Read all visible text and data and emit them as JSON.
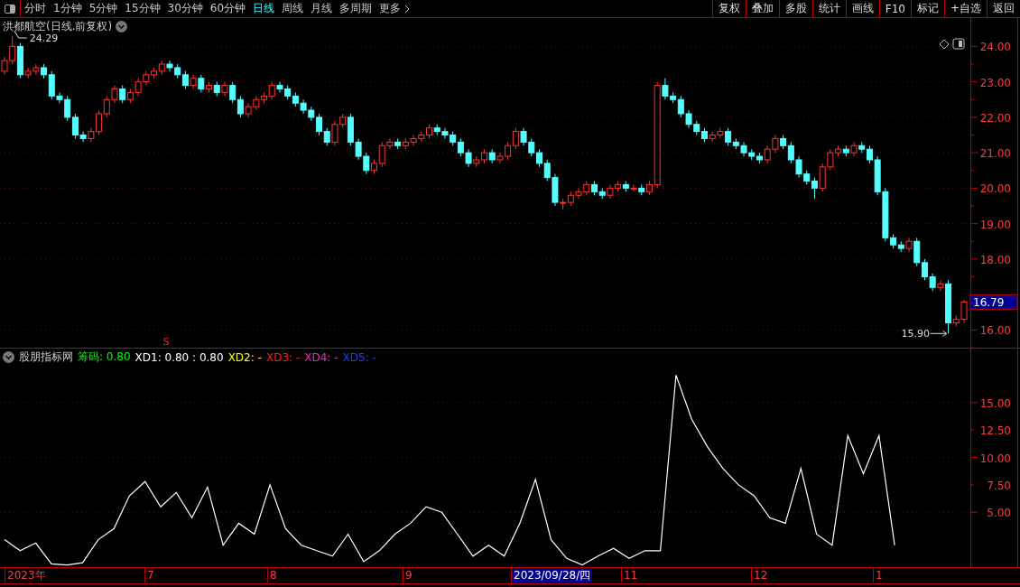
{
  "toolbar": {
    "periods": [
      {
        "label": "分时",
        "selected": false
      },
      {
        "label": "1分钟",
        "selected": false
      },
      {
        "label": "5分钟",
        "selected": false
      },
      {
        "label": "15分钟",
        "selected": false
      },
      {
        "label": "30分钟",
        "selected": false
      },
      {
        "label": "60分钟",
        "selected": false
      },
      {
        "label": "日线",
        "selected": true
      },
      {
        "label": "周线",
        "selected": false
      },
      {
        "label": "月线",
        "selected": false
      },
      {
        "label": "多周期",
        "selected": false
      }
    ],
    "more": "更多",
    "buttons": [
      "复权",
      "叠加",
      "多股",
      "统计",
      "画线",
      "F10",
      "标记",
      "+自选",
      "返回"
    ]
  },
  "price_panel": {
    "title": "洪都航空(日线.前复权)",
    "high_label": "24.29",
    "low_label": "15.90",
    "last_price": "16.79",
    "signal_mark": "S",
    "chart_data": {
      "type": "candlestick",
      "grid": true,
      "ylim": [
        15.5,
        24.8
      ],
      "yticks": [
        {
          "value": 24,
          "label": "24.00"
        },
        {
          "value": 23,
          "label": "23.00"
        },
        {
          "value": 22,
          "label": "22.00"
        },
        {
          "value": 21,
          "label": "21.00"
        },
        {
          "value": 20,
          "label": "20.00"
        },
        {
          "value": 19,
          "label": "19.00"
        },
        {
          "value": 18,
          "label": "18.00"
        },
        {
          "value": 16,
          "label": "16.00"
        }
      ],
      "ohlc": [
        [
          23.3,
          23.7,
          23.2,
          23.6
        ],
        [
          23.6,
          24.29,
          23.5,
          24.0
        ],
        [
          24.0,
          24.1,
          23.1,
          23.2
        ],
        [
          23.2,
          23.4,
          23.1,
          23.3
        ],
        [
          23.3,
          23.5,
          23.2,
          23.4
        ],
        [
          23.4,
          23.5,
          23.1,
          23.2
        ],
        [
          23.2,
          23.3,
          22.5,
          22.6
        ],
        [
          22.6,
          22.7,
          22.4,
          22.5
        ],
        [
          22.5,
          22.6,
          21.9,
          22.0
        ],
        [
          22.0,
          22.1,
          21.4,
          21.5
        ],
        [
          21.5,
          21.6,
          21.3,
          21.4
        ],
        [
          21.4,
          21.7,
          21.3,
          21.6
        ],
        [
          21.6,
          22.2,
          21.5,
          22.1
        ],
        [
          22.1,
          22.6,
          22.0,
          22.5
        ],
        [
          22.5,
          22.9,
          22.4,
          22.8
        ],
        [
          22.8,
          22.9,
          22.4,
          22.5
        ],
        [
          22.5,
          22.8,
          22.4,
          22.7
        ],
        [
          22.7,
          23.1,
          22.6,
          23.0
        ],
        [
          23.0,
          23.3,
          22.9,
          23.2
        ],
        [
          23.2,
          23.4,
          23.1,
          23.3
        ],
        [
          23.3,
          23.6,
          23.2,
          23.5
        ],
        [
          23.5,
          23.6,
          23.3,
          23.4
        ],
        [
          23.4,
          23.5,
          23.1,
          23.2
        ],
        [
          23.2,
          23.3,
          22.8,
          22.9
        ],
        [
          22.9,
          23.2,
          22.8,
          23.1
        ],
        [
          23.1,
          23.2,
          22.7,
          22.8
        ],
        [
          22.8,
          23.0,
          22.7,
          22.9
        ],
        [
          22.9,
          23.0,
          22.6,
          22.7
        ],
        [
          22.7,
          23.0,
          22.6,
          22.9
        ],
        [
          22.9,
          23.0,
          22.4,
          22.5
        ],
        [
          22.5,
          22.6,
          22.0,
          22.1
        ],
        [
          22.1,
          22.4,
          22.0,
          22.3
        ],
        [
          22.3,
          22.6,
          22.2,
          22.5
        ],
        [
          22.5,
          22.7,
          22.4,
          22.6
        ],
        [
          22.6,
          23.0,
          22.5,
          22.9
        ],
        [
          22.9,
          23.0,
          22.7,
          22.8
        ],
        [
          22.8,
          22.9,
          22.5,
          22.6
        ],
        [
          22.6,
          22.7,
          22.3,
          22.4
        ],
        [
          22.4,
          22.5,
          22.1,
          22.2
        ],
        [
          22.2,
          22.3,
          21.9,
          22.0
        ],
        [
          22.0,
          22.1,
          21.5,
          21.6
        ],
        [
          21.6,
          21.7,
          21.2,
          21.3
        ],
        [
          21.3,
          21.9,
          21.2,
          21.8
        ],
        [
          21.8,
          22.1,
          21.7,
          22.0
        ],
        [
          22.0,
          22.1,
          21.2,
          21.3
        ],
        [
          21.3,
          21.4,
          20.8,
          20.9
        ],
        [
          20.9,
          21.0,
          20.4,
          20.5
        ],
        [
          20.5,
          20.8,
          20.4,
          20.7
        ],
        [
          20.7,
          21.3,
          20.6,
          21.2
        ],
        [
          21.2,
          21.4,
          21.1,
          21.3
        ],
        [
          21.3,
          21.4,
          21.1,
          21.2
        ],
        [
          21.2,
          21.4,
          21.1,
          21.3
        ],
        [
          21.3,
          21.5,
          21.2,
          21.4
        ],
        [
          21.4,
          21.6,
          21.3,
          21.5
        ],
        [
          21.5,
          21.8,
          21.4,
          21.7
        ],
        [
          21.7,
          21.8,
          21.5,
          21.6
        ],
        [
          21.6,
          21.7,
          21.4,
          21.5
        ],
        [
          21.5,
          21.6,
          21.2,
          21.3
        ],
        [
          21.3,
          21.4,
          20.9,
          21.0
        ],
        [
          21.0,
          21.1,
          20.6,
          20.7
        ],
        [
          20.7,
          20.9,
          20.6,
          20.8
        ],
        [
          20.8,
          21.1,
          20.7,
          21.0
        ],
        [
          21.0,
          21.1,
          20.7,
          20.8
        ],
        [
          20.8,
          21.0,
          20.7,
          20.9
        ],
        [
          20.9,
          21.3,
          20.8,
          21.2
        ],
        [
          21.2,
          21.7,
          21.1,
          21.6
        ],
        [
          21.6,
          21.7,
          21.2,
          21.3
        ],
        [
          21.3,
          21.4,
          20.9,
          21.0
        ],
        [
          21.0,
          21.1,
          20.6,
          20.7
        ],
        [
          20.7,
          20.8,
          20.2,
          20.3
        ],
        [
          20.3,
          20.4,
          19.5,
          19.6
        ],
        [
          19.6,
          19.7,
          19.4,
          19.6
        ],
        [
          19.6,
          19.9,
          19.5,
          19.8
        ],
        [
          19.8,
          20.0,
          19.7,
          19.9
        ],
        [
          19.9,
          20.2,
          19.8,
          20.1
        ],
        [
          20.1,
          20.2,
          19.8,
          19.9
        ],
        [
          19.9,
          20.0,
          19.7,
          19.8
        ],
        [
          19.8,
          20.1,
          19.7,
          20.0
        ],
        [
          20.0,
          20.2,
          19.9,
          20.1
        ],
        [
          20.1,
          20.2,
          19.9,
          20.0
        ],
        [
          20.0,
          20.1,
          19.9,
          20.0
        ],
        [
          20.0,
          20.1,
          19.8,
          19.9
        ],
        [
          19.9,
          20.2,
          19.8,
          20.1
        ],
        [
          20.1,
          23.0,
          20.0,
          22.9
        ],
        [
          22.9,
          23.1,
          22.5,
          22.6
        ],
        [
          22.6,
          22.7,
          22.4,
          22.5
        ],
        [
          22.5,
          22.6,
          22.0,
          22.1
        ],
        [
          22.1,
          22.2,
          21.7,
          21.8
        ],
        [
          21.8,
          21.9,
          21.5,
          21.6
        ],
        [
          21.6,
          21.7,
          21.3,
          21.4
        ],
        [
          21.4,
          21.6,
          21.3,
          21.5
        ],
        [
          21.5,
          21.7,
          21.4,
          21.6
        ],
        [
          21.6,
          21.7,
          21.2,
          21.3
        ],
        [
          21.3,
          21.4,
          21.1,
          21.2
        ],
        [
          21.2,
          21.3,
          20.9,
          21.0
        ],
        [
          21.0,
          21.1,
          20.8,
          20.9
        ],
        [
          20.9,
          21.0,
          20.7,
          20.8
        ],
        [
          20.8,
          21.2,
          20.7,
          21.1
        ],
        [
          21.1,
          21.5,
          21.0,
          21.4
        ],
        [
          21.4,
          21.5,
          21.1,
          21.2
        ],
        [
          21.2,
          21.3,
          20.7,
          20.8
        ],
        [
          20.8,
          20.9,
          20.3,
          20.4
        ],
        [
          20.4,
          20.5,
          20.1,
          20.2
        ],
        [
          20.2,
          20.3,
          19.7,
          20.0
        ],
        [
          20.0,
          20.7,
          19.9,
          20.6
        ],
        [
          20.6,
          21.1,
          20.5,
          21.0
        ],
        [
          21.0,
          21.2,
          20.9,
          21.1
        ],
        [
          21.1,
          21.2,
          20.9,
          21.0
        ],
        [
          21.0,
          21.3,
          20.9,
          21.2
        ],
        [
          21.2,
          21.3,
          21.0,
          21.1
        ],
        [
          21.1,
          21.2,
          20.7,
          20.8
        ],
        [
          20.8,
          20.9,
          19.8,
          19.9
        ],
        [
          19.9,
          20.0,
          18.5,
          18.6
        ],
        [
          18.6,
          18.7,
          18.3,
          18.4
        ],
        [
          18.4,
          18.5,
          18.2,
          18.3
        ],
        [
          18.3,
          18.6,
          18.2,
          18.5
        ],
        [
          18.5,
          18.6,
          17.8,
          17.9
        ],
        [
          17.9,
          18.0,
          17.4,
          17.5
        ],
        [
          17.5,
          17.6,
          17.1,
          17.2
        ],
        [
          17.2,
          17.4,
          17.1,
          17.3
        ],
        [
          17.3,
          17.4,
          15.9,
          16.2
        ],
        [
          16.2,
          16.4,
          16.1,
          16.3
        ],
        [
          16.3,
          16.85,
          16.2,
          16.79
        ]
      ]
    }
  },
  "indicator_panel": {
    "name": "股朋指标网",
    "legend": [
      {
        "label": "筹码:",
        "value": "0.80",
        "color": "#00ff00"
      },
      {
        "label": "XD1:",
        "value": "0.80 : 0.80",
        "color": "#ffffff"
      },
      {
        "label": "XD2:",
        "value": "-",
        "color": "#ffff00"
      },
      {
        "label": "XD3:",
        "value": "-",
        "color": "#ff2020"
      },
      {
        "label": "XD4:",
        "value": "-",
        "color": "#ff20c0"
      },
      {
        "label": "XD5:",
        "value": "-",
        "color": "#2040ff"
      }
    ],
    "chart_data": {
      "type": "line",
      "grid": true,
      "ylim": [
        0,
        20
      ],
      "yticks": [
        {
          "value": 15,
          "label": "15.00"
        },
        {
          "value": 12.5,
          "label": "12.50"
        },
        {
          "value": 10,
          "label": "10.00"
        },
        {
          "value": 7.5,
          "label": "7.50"
        },
        {
          "value": 5,
          "label": "5.00"
        }
      ],
      "series": [
        {
          "color": "#ffffff",
          "values": [
            2.5,
            1.5,
            2.2,
            0.3,
            0.2,
            0.4,
            2.5,
            3.5,
            6.5,
            7.8,
            5.5,
            6.8,
            4.5,
            7.3,
            2.0,
            4.0,
            3.0,
            7.5,
            3.5,
            2.0,
            1.5,
            1.0,
            3.0,
            0.5,
            1.5,
            3.0,
            4.0,
            5.5,
            5.0,
            3.0,
            1.0,
            2.0,
            1.0,
            4.0,
            8.0,
            2.5,
            0.8,
            0.2,
            1.0,
            1.7,
            0.8,
            1.5,
            1.5,
            17.5,
            13.5,
            11.0,
            9.0,
            7.5,
            6.5,
            4.5,
            4.0,
            9.0,
            3.0,
            2.0,
            12.0,
            8.5,
            12.0,
            2.0
          ]
        }
      ]
    }
  },
  "time_axis": [
    {
      "label": "2023年",
      "selected": false
    },
    {
      "label": "7",
      "selected": false
    },
    {
      "label": "8",
      "selected": false
    },
    {
      "label": "9",
      "selected": false
    },
    {
      "label": "2023/09/28/四",
      "selected": true
    },
    {
      "label": "11",
      "selected": false
    },
    {
      "label": "12",
      "selected": false
    },
    {
      "label": "1",
      "selected": false
    }
  ]
}
